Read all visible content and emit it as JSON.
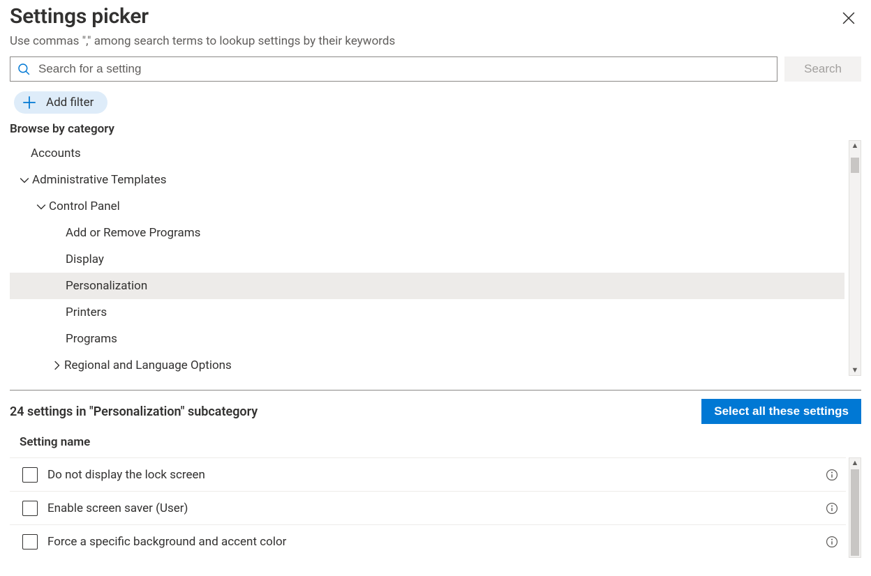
{
  "header": {
    "title": "Settings picker",
    "subtitle": "Use commas \",\" among search terms to lookup settings by their keywords"
  },
  "search": {
    "placeholder": "Search for a setting",
    "button_label": "Search"
  },
  "filter": {
    "add_label": "Add filter"
  },
  "browse_label": "Browse by category",
  "tree": {
    "items": [
      {
        "label": "Accounts"
      },
      {
        "label": "Administrative Templates"
      },
      {
        "label": "Control Panel"
      },
      {
        "label": "Add or Remove Programs"
      },
      {
        "label": "Display"
      },
      {
        "label": "Personalization"
      },
      {
        "label": "Printers"
      },
      {
        "label": "Programs"
      },
      {
        "label": "Regional and Language Options"
      }
    ]
  },
  "results": {
    "count_text": "24 settings in \"Personalization\" subcategory",
    "select_all_label": "Select all these settings",
    "column_header": "Setting name",
    "rows": [
      {
        "name": "Do not display the lock screen"
      },
      {
        "name": "Enable screen saver (User)"
      },
      {
        "name": "Force a specific background and accent color"
      }
    ]
  }
}
